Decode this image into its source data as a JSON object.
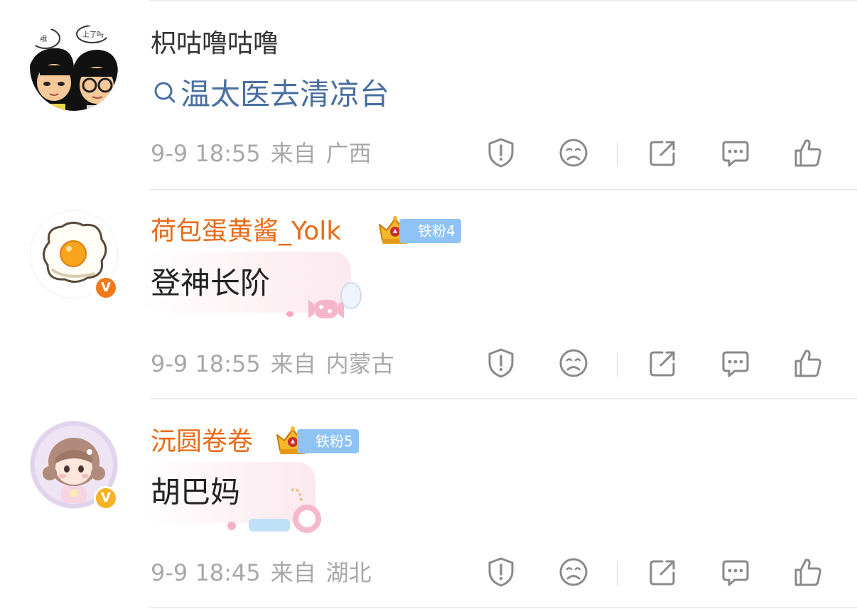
{
  "comments": [
    {
      "username": "枳咕噜咕噜",
      "search_text": "温太医去清凉台",
      "date": "9-9 18:55",
      "source_label": "来自",
      "location": "广西"
    },
    {
      "username": "荷包蛋黄酱_Yolk",
      "fan_badge": "铁粉4",
      "text": "登神长阶",
      "date": "9-9 18:55",
      "source_label": "来自",
      "location": "内蒙古"
    },
    {
      "username": "沅圆卷卷",
      "fan_badge": "铁粉5",
      "text": "胡巴妈",
      "date": "9-9 18:45",
      "source_label": "来自",
      "location": "湖北"
    }
  ],
  "icons": {
    "report": "shield-exclamation-icon",
    "dislike": "sad-face-icon",
    "share": "share-icon",
    "reply": "comment-icon",
    "like": "thumbs-up-icon",
    "verified": "v-badge-icon",
    "crown": "crown-icon"
  },
  "colors": {
    "username_highlight": "#e86b17",
    "link": "#4a6fa0",
    "meta": "#a8a8a8",
    "fan_badge": "#8fc3f5",
    "verified_orange": "#f07a1a",
    "verified_gold": "#f6b323"
  }
}
